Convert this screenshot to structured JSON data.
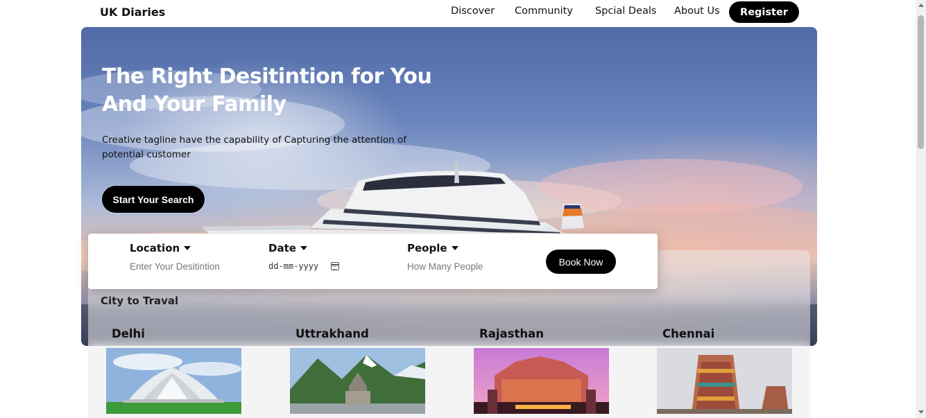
{
  "nav": {
    "brand": "UK Diaries",
    "links": [
      "Discover",
      "Community",
      "Spcial Deals",
      "About Us"
    ],
    "register_label": "Register"
  },
  "hero": {
    "title_line1": "The Right Desitintion for You",
    "title_line2": "And Your Family",
    "tagline": "Creative tagline have the capability of Capturing the attention of potential customer",
    "cta_label": "Start Your Search"
  },
  "booking": {
    "location": {
      "label": "Location",
      "placeholder": "Enter Your Desitintion"
    },
    "date": {
      "label": "Date",
      "value": "dd-mm-yyyy"
    },
    "people": {
      "label": "People",
      "placeholder": "How Many People"
    },
    "book_label": "Book Now"
  },
  "cities": {
    "heading": "City to Traval",
    "items": [
      {
        "name": "Delhi",
        "image_icon": "lotus-temple-image"
      },
      {
        "name": "Uttrakhand",
        "image_icon": "kedarnath-temple-image"
      },
      {
        "name": "Rajasthan",
        "image_icon": "hawa-mahal-image"
      },
      {
        "name": "Chennai",
        "image_icon": "gopuram-temple-image"
      }
    ]
  },
  "colors": {
    "button_bg": "#000000",
    "button_text": "#ffffff",
    "hero_sky_top": "#4f6aa6",
    "hero_sky_glow": "#e7c3b4"
  }
}
